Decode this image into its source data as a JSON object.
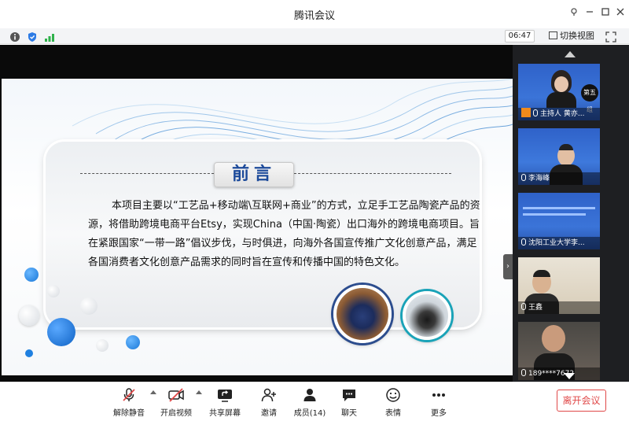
{
  "window": {
    "title": "腾讯会议"
  },
  "infobar": {
    "timer": "06:47",
    "switch_view_label": "切换视图"
  },
  "slide": {
    "heading": "前言",
    "body": "本项目主要以“工艺品+移动端\\互联网+商业”的方式，立足手工艺品陶瓷产品的资源，将借助跨境电商平台Etsy，实现China（中国·陶瓷）出口海外的跨境电商项目。旨在紧跟国家“一带一路”倡议步伐，与时俱进，向海外各国宣传推广文化创意产品，满足各国消费者文化创意产品需求的同时旨在宣传和传播中国的特色文化。"
  },
  "participants": [
    {
      "name": "主持人 黄亦...",
      "badge": "第五组",
      "role": "host"
    },
    {
      "name": "李海峰"
    },
    {
      "name": "沈阳工业大学李..."
    },
    {
      "name": "王鑫"
    },
    {
      "name": "189****7672"
    }
  ],
  "toolbar": {
    "unmute": "解除静音",
    "start_video": "开启视频",
    "share_screen": "共享屏幕",
    "invite": "邀请",
    "members": "成员(14)",
    "chat": "聊天",
    "reactions": "表情",
    "more": "更多",
    "leave": "离开会议"
  },
  "colors": {
    "leave_red": "#e04848",
    "heading_blue": "#1c4a9a",
    "host_orange": "#f08a1c",
    "signal_green": "#2fb14b"
  }
}
